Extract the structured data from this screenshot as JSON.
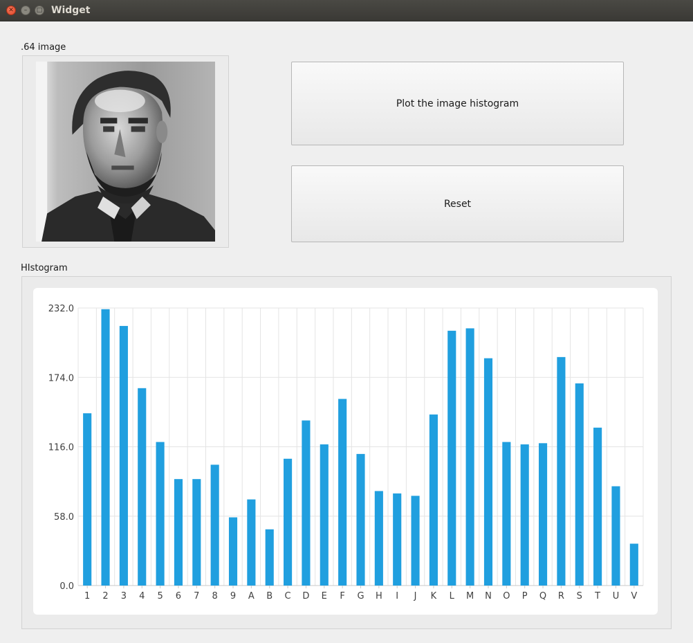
{
  "window": {
    "title": "Widget"
  },
  "image_group": {
    "label": ".64 image"
  },
  "buttons": {
    "plot": "Plot the image histogram",
    "reset": "Reset"
  },
  "histogram_group": {
    "label": "HIstogram"
  },
  "colors": {
    "bar": "#209fdf",
    "grid": "#e4e4e4",
    "panel": "#ffffff"
  },
  "chart_data": {
    "type": "bar",
    "categories": [
      "1",
      "2",
      "3",
      "4",
      "5",
      "6",
      "7",
      "8",
      "9",
      "A",
      "B",
      "C",
      "D",
      "E",
      "F",
      "G",
      "H",
      "I",
      "J",
      "K",
      "L",
      "M",
      "N",
      "O",
      "P",
      "Q",
      "R",
      "S",
      "T",
      "U",
      "V"
    ],
    "values": [
      144,
      231,
      217,
      165,
      120,
      89,
      89,
      101,
      57,
      72,
      47,
      106,
      138,
      118,
      156,
      110,
      79,
      77,
      75,
      143,
      213,
      215,
      190,
      120,
      118,
      119,
      191,
      169,
      132,
      83,
      35
    ],
    "yticks": [
      "232.0",
      "174.0",
      "116.0",
      "58.0",
      "0.0"
    ],
    "ylim": [
      0,
      232
    ],
    "grid": true
  }
}
